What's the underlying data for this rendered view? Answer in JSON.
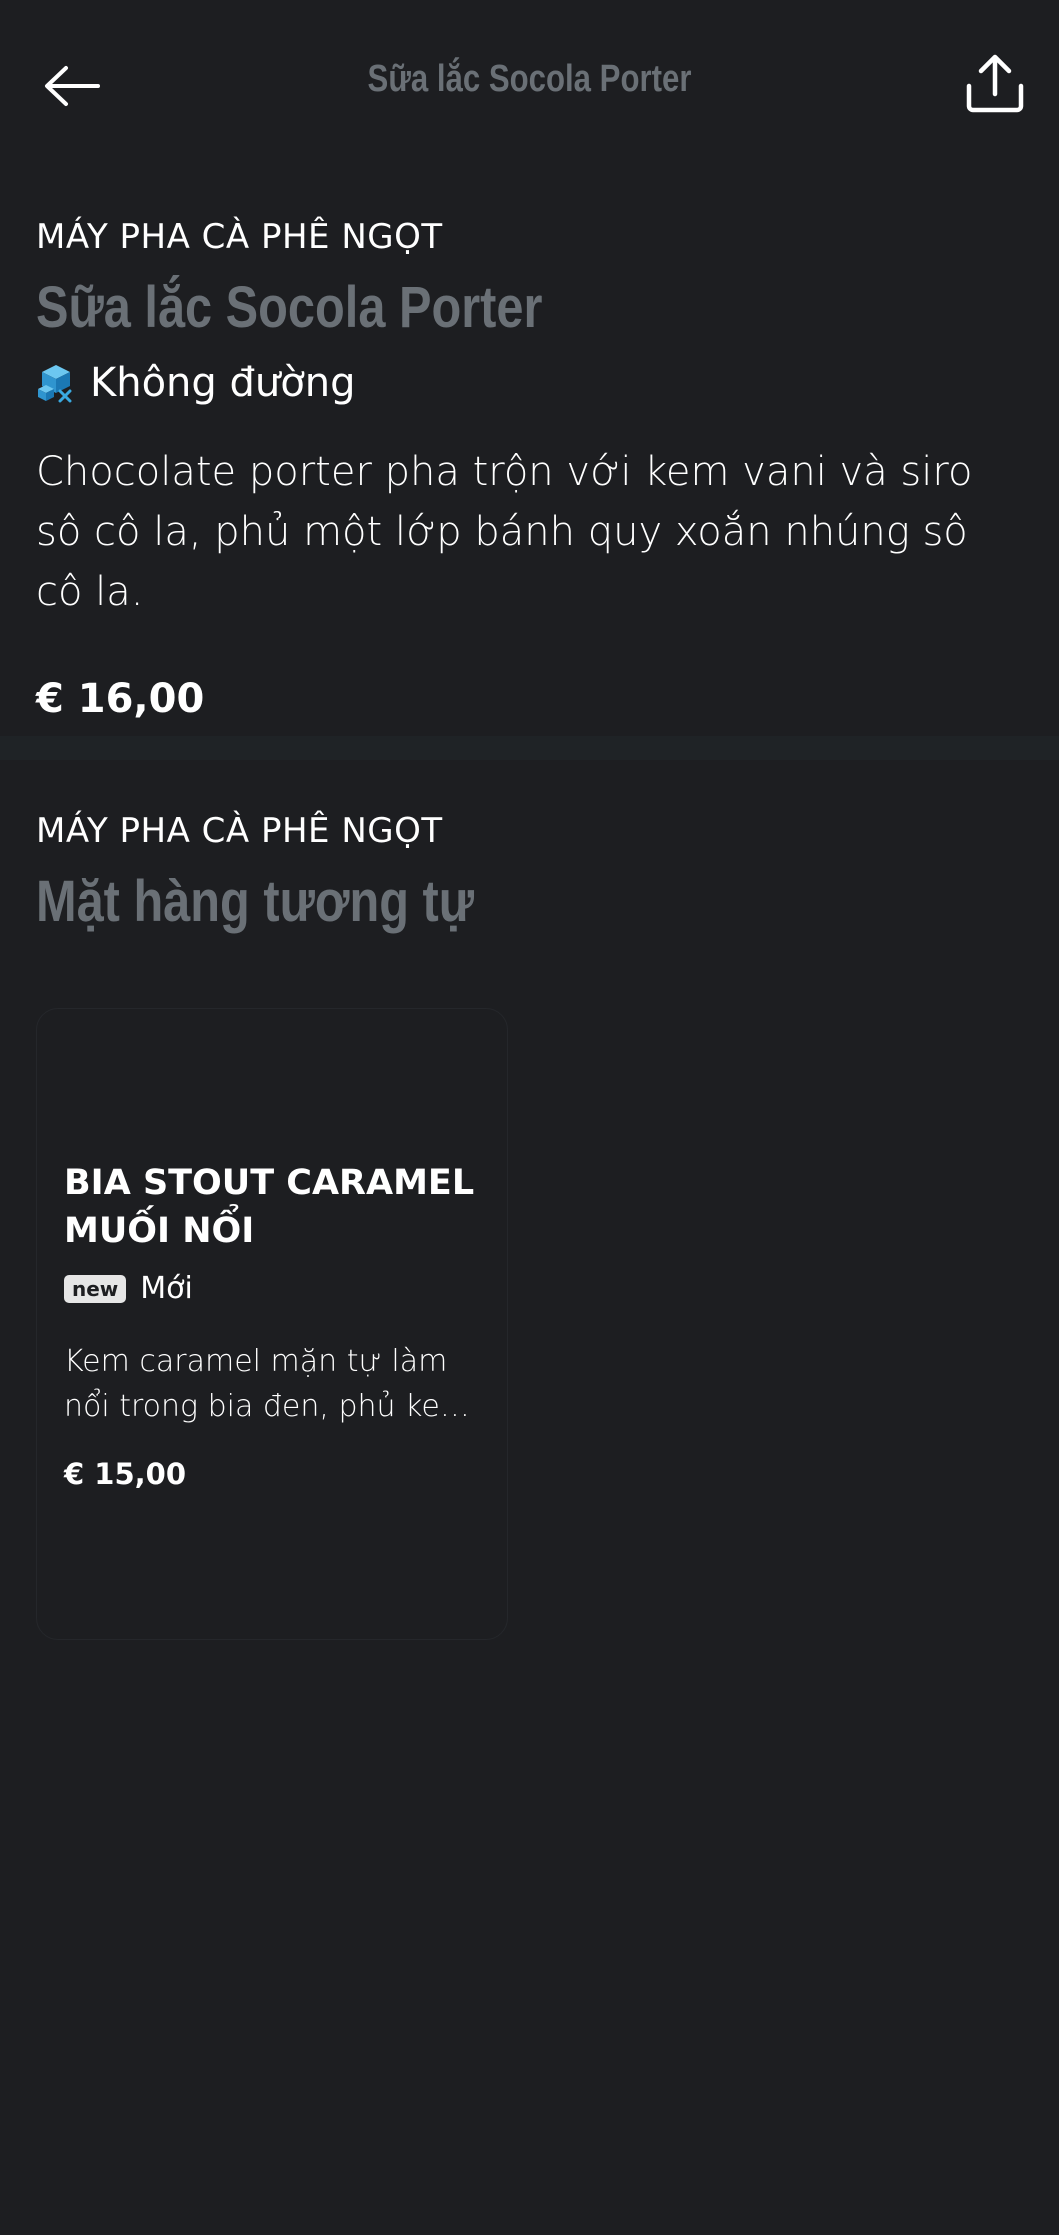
{
  "header": {
    "title": "Sữa lắc Socola Porter",
    "back_icon": "arrow-left-icon",
    "share_icon": "share-icon"
  },
  "product": {
    "category": "MÁY PHA CÀ PHÊ NGỌT",
    "name": "Sữa lắc Socola Porter",
    "tag_icon": "sugar-free-icon",
    "tag_label": "Không đường",
    "description": "Chocolate porter pha trộn với kem vani và siro sô cô la, phủ một lớp bánh quy xoắn nhúng sô cô la.",
    "price": "€ 16,00"
  },
  "similar": {
    "category": "MÁY PHA CÀ PHÊ NGỌT",
    "heading": "Mặt hàng tương tự",
    "items": [
      {
        "name": "BIA STOUT CARAMEL MUỐI NỔI",
        "badge": "new",
        "badge_label": "Mới",
        "description": "Kem caramel mặn tự làm nổi trong bia đen, phủ kem tươi và sốt caramel.",
        "price": "€ 15,00"
      }
    ]
  },
  "colors": {
    "background": "#1d1e21",
    "muted_title": "#6a7076",
    "divider": "#1f2326",
    "accent_icon": "#3aa9e0"
  }
}
